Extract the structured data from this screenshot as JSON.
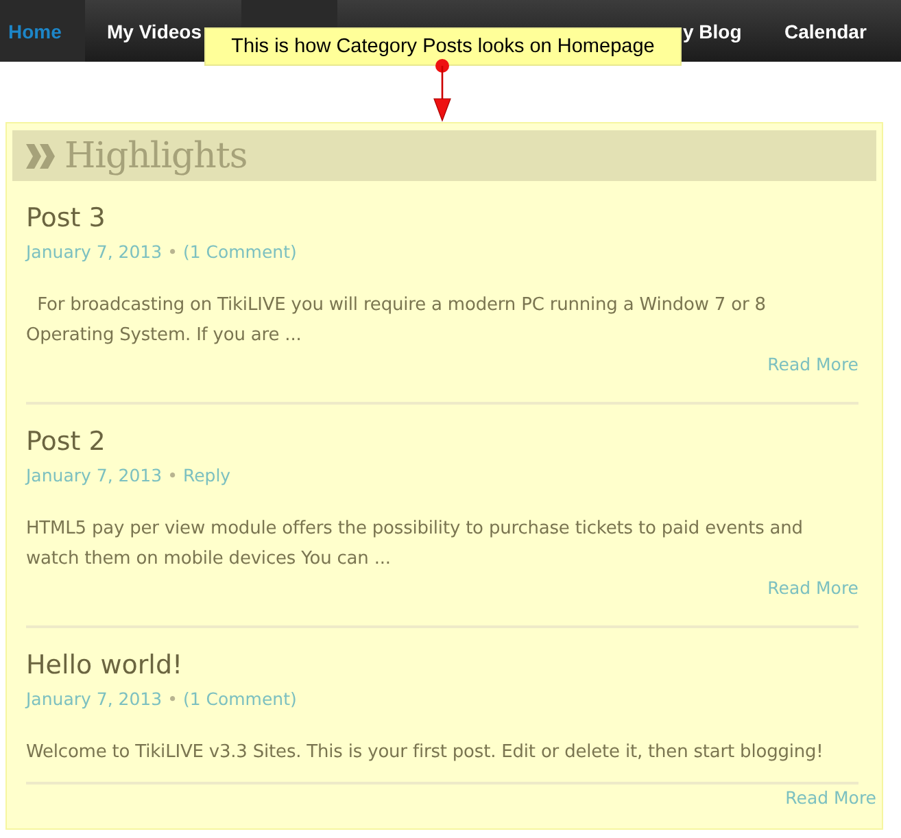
{
  "nav": {
    "items": [
      {
        "kind": "link",
        "label": "Home",
        "selected": true
      },
      {
        "kind": "link",
        "label": "My Videos",
        "selected": false
      },
      {
        "kind": "covered",
        "selected": true
      },
      {
        "kind": "covered",
        "selected": false
      },
      {
        "kind": "covered",
        "selected": false
      },
      {
        "kind": "link",
        "label": "y Blog",
        "selected": false
      },
      {
        "kind": "link",
        "label": "Calendar",
        "selected": false
      }
    ]
  },
  "callout": {
    "text": "This is how Category Posts looks on Homepage"
  },
  "widget": {
    "title": "Highlights",
    "posts": [
      {
        "title": "Post 3",
        "date": "January 7, 2013",
        "separator": "•",
        "comments": "(1 Comment)",
        "excerpt": "  For broadcasting on TikiLIVE you will require a modern PC running a Window 7 or 8 Operating System. If you are ...",
        "read_more": "Read More"
      },
      {
        "title": "Post 2",
        "date": "January 7, 2013",
        "separator": "•",
        "comments": "Reply",
        "excerpt": "HTML5 pay per view module offers the possibility to purchase tickets to paid events and watch them on mobile devices You can ...",
        "read_more": "Read More"
      },
      {
        "title": "Hello world!",
        "date": "January 7, 2013",
        "separator": "•",
        "comments": "(1 Comment)",
        "excerpt": "Welcome to TikiLIVE v3.3 Sites. This is your first post. Edit or delete it, then start blogging!",
        "read_more": "Read More"
      }
    ]
  }
}
